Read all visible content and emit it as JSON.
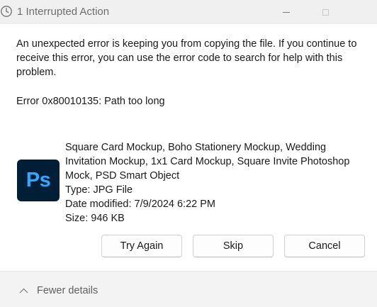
{
  "window": {
    "title": "1 Interrupted Action"
  },
  "message": {
    "body": "An unexpected error is keeping you from copying the file. If you continue to receive this error, you can use the error code to search for help with this problem.",
    "error_code": "Error 0x80010135: Path too long"
  },
  "file": {
    "icon_text": "Ps",
    "icon_name": "photoshop-file-icon",
    "name": "Square Card Mockup, Boho Stationery Mockup, Wedding Invitation Mockup, 1x1 Card Mockup, Square Invite Photoshop Mock, PSD Smart Object",
    "type": "Type: JPG File",
    "date_modified": "Date modified: 7/9/2024 6:22 PM",
    "size": "Size: 946 KB"
  },
  "buttons": {
    "try_again": "Try Again",
    "skip": "Skip",
    "cancel": "Cancel"
  },
  "footer": {
    "fewer_details": "Fewer details"
  },
  "colors": {
    "ps_background": "#001e36",
    "ps_text": "#31a8ff",
    "window_background": "#ffffff",
    "footer_background": "#f3f3f3"
  }
}
